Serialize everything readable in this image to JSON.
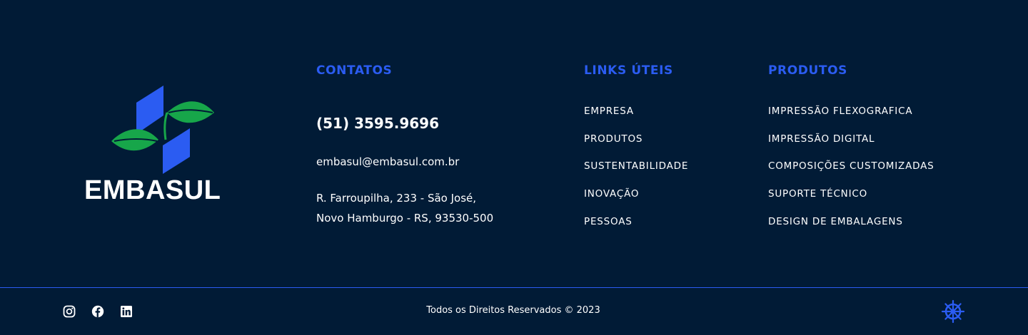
{
  "brand": {
    "name": "EMBASUL",
    "logo": "embasul-logo",
    "colors": {
      "blue": "#2b5cf2",
      "green": "#17a64a",
      "background": "#011b36"
    }
  },
  "contacts": {
    "title": "CONTATOS",
    "phone": "(51) 3595.9696",
    "email": "embasul@embasul.com.br",
    "address_line1": "R. Farroupilha, 233 - São José,",
    "address_line2": "Novo Hamburgo - RS, 93530-500"
  },
  "links": {
    "title": "LINKS ÚTEIS",
    "items": [
      "EMPRESA",
      "PRODUTOS",
      "SUSTENTABILIDADE",
      "INOVAÇÃO",
      "PESSOAS"
    ]
  },
  "products": {
    "title": "PRODUTOS",
    "items": [
      "IMPRESSÃO FLEXOGRAFICA",
      "IMPRESSÃO DIGITAL",
      "COMPOSIÇÕES CUSTOMIZADAS",
      "SUPORTE TÉCNICO",
      "DESIGN DE EMBALAGENS"
    ]
  },
  "footer": {
    "copyright": "Todos os Direitos Reservados © 2023",
    "social": [
      "instagram-icon",
      "facebook-icon",
      "linkedin-icon"
    ],
    "helm_icon": "ship-wheel-icon"
  }
}
